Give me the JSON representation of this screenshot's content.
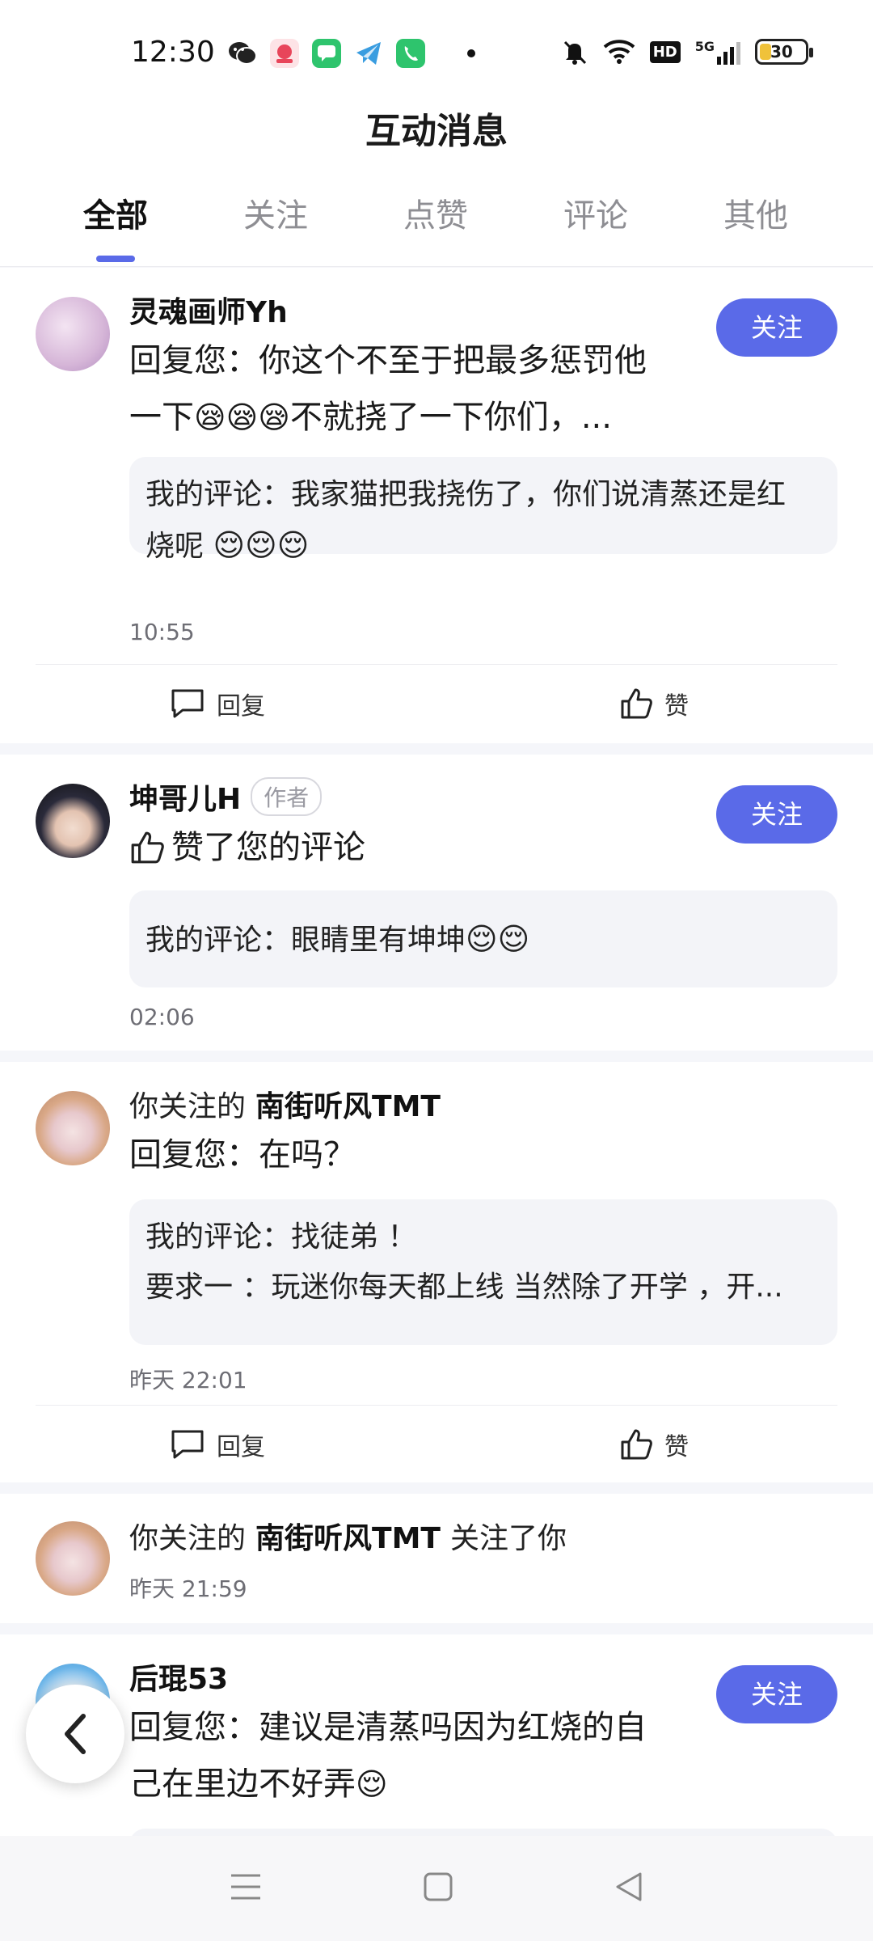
{
  "status_bar": {
    "time": "12:30",
    "battery": "30",
    "hd_label": "HD",
    "net_label": "5G",
    "app_icons": [
      "wechat-icon",
      "game-app-icon",
      "message-app-icon",
      "telegram-icon",
      "phone-app-icon"
    ]
  },
  "header": {
    "title": "互动消息"
  },
  "tabs": [
    {
      "label": "全部"
    },
    {
      "label": "关注"
    },
    {
      "label": "点赞"
    },
    {
      "label": "评论"
    },
    {
      "label": "其他"
    }
  ],
  "items": [
    {
      "name": "灵魂画师Yh",
      "follow": "关注",
      "message_line1": "回复您：你这个不至于把最多惩罚他",
      "message_line2_a": "一下",
      "message_line2_b": "不就挠了一下你们，...",
      "quote_line1": "我的评论：我家猫把我挠伤了，你们说清蒸还是红",
      "quote_line2": "烧呢",
      "time": "10:55",
      "reply": "回复",
      "like": "赞"
    },
    {
      "name": "坤哥儿H",
      "author_tag": "作者",
      "follow": "关注",
      "message": "赞了您的评论",
      "quote": "我的评论：眼睛里有坤坤",
      "time": "02:06"
    },
    {
      "prefix": "你关注的",
      "name": "南街听风TMT",
      "message": "回复您：在吗？",
      "quote_line1": "我的评论：找徒弟 ！",
      "quote_line2": "要求一 ：玩迷你每天都上线 当然除了开学 ，开...",
      "time": "昨天 22:01",
      "reply": "回复",
      "like": "赞"
    },
    {
      "prefix": "你关注的",
      "name": "南街听风TMT",
      "suffix": "关注了你",
      "time": "昨天 21:59"
    },
    {
      "name": "后琨53",
      "follow": "关注",
      "message_line1": "回复您：建议是清蒸吗因为红烧的自",
      "message_line2": "己在里边不好弄"
    }
  ],
  "colors": {
    "accent": "#5a6ae8",
    "background": "#f5f6fa"
  }
}
